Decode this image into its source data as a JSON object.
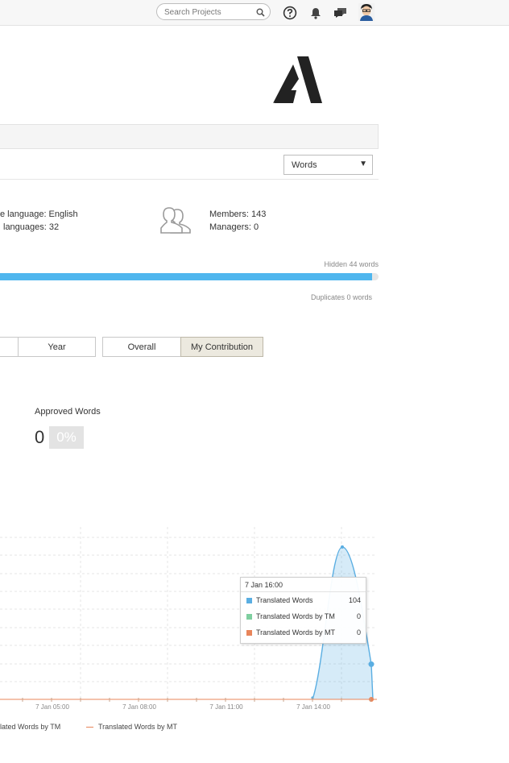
{
  "header": {
    "search_placeholder": "Search Projects",
    "icons": [
      "search-icon",
      "help-icon",
      "bell-icon",
      "messages-icon",
      "avatar"
    ]
  },
  "unit_select": {
    "value": "Words",
    "arrow": "▼"
  },
  "info": {
    "source_language_text": "e language: English",
    "target_languages_text": "languages: 32",
    "members_text": "Members: 143",
    "managers_text": "Managers: 0"
  },
  "progress": {
    "hidden_text": "Hidden 44 words",
    "duplicates_text": "Duplicates 0 words",
    "fill_fraction": 0.98,
    "color": "#4fb6ee"
  },
  "periods": {
    "year_label": "Year"
  },
  "scope_tabs": {
    "overall_label": "Overall",
    "my_contribution_label": "My Contribution",
    "active": "My Contribution"
  },
  "stats": {
    "approved_label": "Approved Words",
    "approved_value": "0",
    "approved_percent": "0%"
  },
  "chart_data": {
    "type": "area",
    "x_tick_labels": [
      "7 Jan 05:00",
      "7 Jan 08:00",
      "7 Jan 11:00",
      "7 Jan 14:00"
    ],
    "series": [
      {
        "name": "Translated Words",
        "color": "#5aaee2",
        "points": [
          [
            "7 Jan 14:00",
            0
          ],
          [
            "7 Jan 16:00",
            104
          ],
          [
            "7 Jan 17:00",
            24
          ],
          [
            "7 Jan 17:00",
            0
          ]
        ]
      },
      {
        "name": "Translated Words by TM",
        "color": "#7fcfa0",
        "values": "all 0"
      },
      {
        "name": "Translated Words by MT",
        "color": "#e8855a",
        "values": "all 0"
      }
    ],
    "tooltip": {
      "title": "7 Jan 16:00",
      "rows": [
        {
          "name": "Translated Words",
          "value": "104",
          "color": "#5aaee2"
        },
        {
          "name": "Translated Words by TM",
          "value": "0",
          "color": "#7fcfa0"
        },
        {
          "name": "Translated Words by MT",
          "value": "0",
          "color": "#e8855a"
        }
      ]
    },
    "legend": [
      {
        "label": "lated Words by TM",
        "color": "#7fcfa0"
      },
      {
        "label": "Translated Words by MT",
        "color": "#e8855a"
      }
    ]
  }
}
